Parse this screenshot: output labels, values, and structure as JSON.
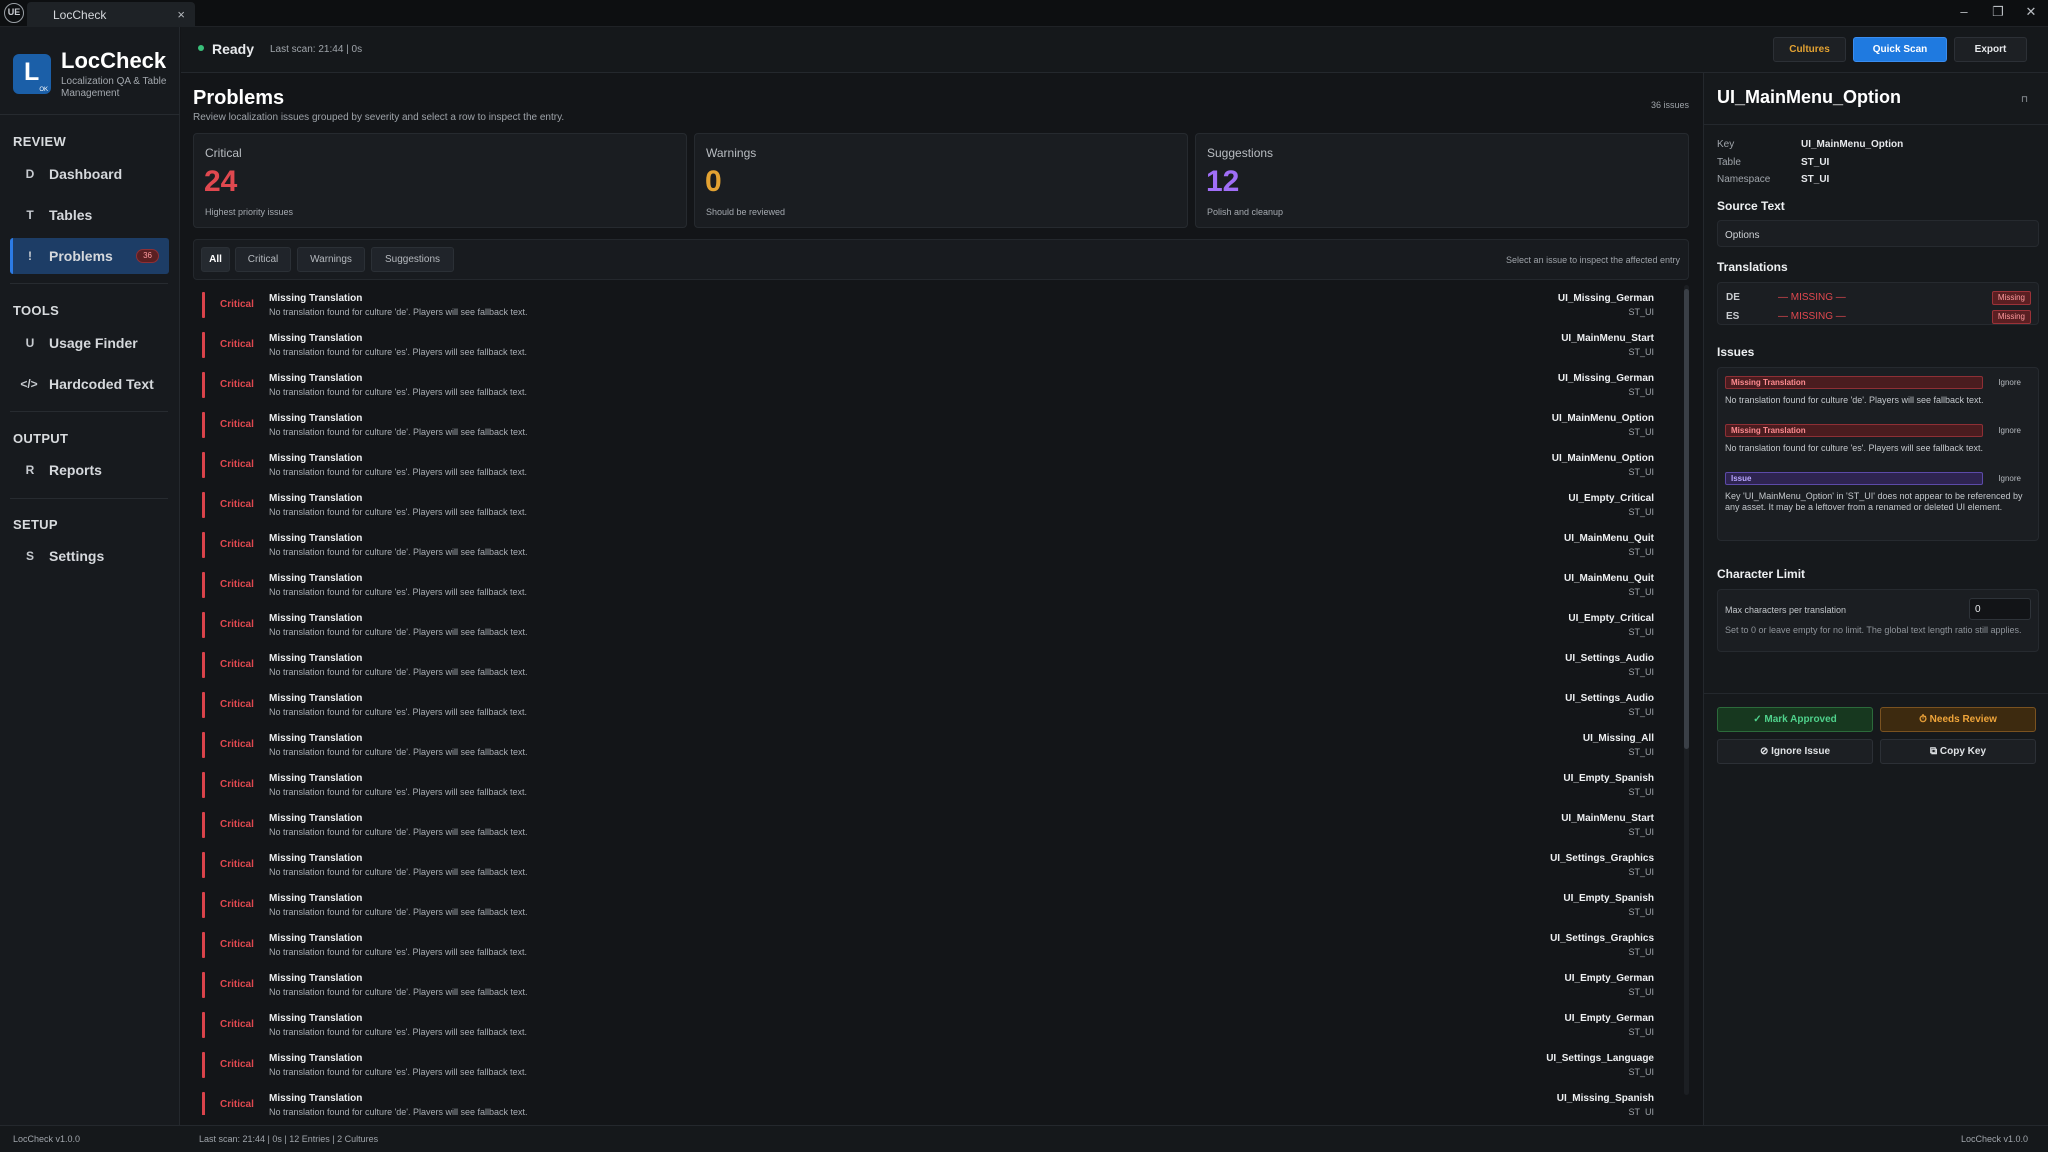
{
  "window": {
    "logo": "UE",
    "tab_label": "LocCheck",
    "tab_close": "×",
    "minimize": "–",
    "restore": "❐",
    "close": "✕"
  },
  "brand": {
    "logo_letter": "L",
    "logo_badge": "OK",
    "title": "LocCheck",
    "subtitle": "Localization QA & Table Management"
  },
  "sidebar": {
    "sections": [
      {
        "label": "REVIEW",
        "items": [
          {
            "icon": "D",
            "label": "Dashboard",
            "active": false
          },
          {
            "icon": "T",
            "label": "Tables",
            "active": false
          },
          {
            "icon": "!",
            "label": "Problems",
            "active": true,
            "badge": "36"
          }
        ]
      },
      {
        "label": "TOOLS",
        "items": [
          {
            "icon": "U",
            "label": "Usage Finder",
            "active": false
          },
          {
            "icon": "</>",
            "label": "Hardcoded Text",
            "active": false
          }
        ]
      },
      {
        "label": "OUTPUT",
        "items": [
          {
            "icon": "R",
            "label": "Reports",
            "active": false
          }
        ]
      },
      {
        "label": "SETUP",
        "items": [
          {
            "icon": "S",
            "label": "Settings",
            "active": false
          }
        ]
      }
    ]
  },
  "topbar": {
    "status": "Ready",
    "last_scan": "Last scan: 21:44  |  0s",
    "buttons": {
      "cultures": "Cultures",
      "quick_scan": "Quick Scan",
      "export": "Export"
    }
  },
  "colors": {
    "accent": "#1f7ae0",
    "critical": "#e0484f",
    "warning": "#e3a232",
    "suggestion": "#a06ef7",
    "approve": "#4fd18b",
    "review": "#f0a53a"
  },
  "main": {
    "title": "Problems",
    "subtitle": "Review localization issues grouped by severity and select a row to inspect the entry.",
    "issue_count": "36 issues",
    "cards": [
      {
        "title": "Critical",
        "value": "24",
        "sub": "Highest priority issues"
      },
      {
        "title": "Warnings",
        "value": "0",
        "sub": "Should be reviewed"
      },
      {
        "title": "Suggestions",
        "value": "12",
        "sub": "Polish and cleanup"
      }
    ],
    "filters": [
      "All",
      "Critical",
      "Warnings",
      "Suggestions"
    ],
    "active_filter": "All",
    "filter_hint": "Select an issue to inspect the affected entry",
    "rows": [
      {
        "severity": "Critical",
        "title": "Missing Translation",
        "desc": "No translation found for culture 'de'. Players will see fallback text.",
        "key": "UI_Missing_German",
        "table": "ST_UI"
      },
      {
        "severity": "Critical",
        "title": "Missing Translation",
        "desc": "No translation found for culture 'es'. Players will see fallback text.",
        "key": "UI_MainMenu_Start",
        "table": "ST_UI"
      },
      {
        "severity": "Critical",
        "title": "Missing Translation",
        "desc": "No translation found for culture 'es'. Players will see fallback text.",
        "key": "UI_Missing_German",
        "table": "ST_UI"
      },
      {
        "severity": "Critical",
        "title": "Missing Translation",
        "desc": "No translation found for culture 'de'. Players will see fallback text.",
        "key": "UI_MainMenu_Option",
        "table": "ST_UI"
      },
      {
        "severity": "Critical",
        "title": "Missing Translation",
        "desc": "No translation found for culture 'es'. Players will see fallback text.",
        "key": "UI_MainMenu_Option",
        "table": "ST_UI"
      },
      {
        "severity": "Critical",
        "title": "Missing Translation",
        "desc": "No translation found for culture 'es'. Players will see fallback text.",
        "key": "UI_Empty_Critical",
        "table": "ST_UI"
      },
      {
        "severity": "Critical",
        "title": "Missing Translation",
        "desc": "No translation found for culture 'de'. Players will see fallback text.",
        "key": "UI_MainMenu_Quit",
        "table": "ST_UI"
      },
      {
        "severity": "Critical",
        "title": "Missing Translation",
        "desc": "No translation found for culture 'es'. Players will see fallback text.",
        "key": "UI_MainMenu_Quit",
        "table": "ST_UI"
      },
      {
        "severity": "Critical",
        "title": "Missing Translation",
        "desc": "No translation found for culture 'de'. Players will see fallback text.",
        "key": "UI_Empty_Critical",
        "table": "ST_UI"
      },
      {
        "severity": "Critical",
        "title": "Missing Translation",
        "desc": "No translation found for culture 'de'. Players will see fallback text.",
        "key": "UI_Settings_Audio",
        "table": "ST_UI"
      },
      {
        "severity": "Critical",
        "title": "Missing Translation",
        "desc": "No translation found for culture 'es'. Players will see fallback text.",
        "key": "UI_Settings_Audio",
        "table": "ST_UI"
      },
      {
        "severity": "Critical",
        "title": "Missing Translation",
        "desc": "No translation found for culture 'de'. Players will see fallback text.",
        "key": "UI_Missing_All",
        "table": "ST_UI"
      },
      {
        "severity": "Critical",
        "title": "Missing Translation",
        "desc": "No translation found for culture 'es'. Players will see fallback text.",
        "key": "UI_Empty_Spanish",
        "table": "ST_UI"
      },
      {
        "severity": "Critical",
        "title": "Missing Translation",
        "desc": "No translation found for culture 'de'. Players will see fallback text.",
        "key": "UI_MainMenu_Start",
        "table": "ST_UI"
      },
      {
        "severity": "Critical",
        "title": "Missing Translation",
        "desc": "No translation found for culture 'de'. Players will see fallback text.",
        "key": "UI_Settings_Graphics",
        "table": "ST_UI"
      },
      {
        "severity": "Critical",
        "title": "Missing Translation",
        "desc": "No translation found for culture 'de'. Players will see fallback text.",
        "key": "UI_Empty_Spanish",
        "table": "ST_UI"
      },
      {
        "severity": "Critical",
        "title": "Missing Translation",
        "desc": "No translation found for culture 'es'. Players will see fallback text.",
        "key": "UI_Settings_Graphics",
        "table": "ST_UI"
      },
      {
        "severity": "Critical",
        "title": "Missing Translation",
        "desc": "No translation found for culture 'de'. Players will see fallback text.",
        "key": "UI_Empty_German",
        "table": "ST_UI"
      },
      {
        "severity": "Critical",
        "title": "Missing Translation",
        "desc": "No translation found for culture 'es'. Players will see fallback text.",
        "key": "UI_Empty_German",
        "table": "ST_UI"
      },
      {
        "severity": "Critical",
        "title": "Missing Translation",
        "desc": "No translation found for culture 'es'. Players will see fallback text.",
        "key": "UI_Settings_Language",
        "table": "ST_UI"
      },
      {
        "severity": "Critical",
        "title": "Missing Translation",
        "desc": "No translation found for culture 'de'. Players will see fallback text.",
        "key": "UI_Missing_Spanish",
        "table": "ST_UI"
      }
    ]
  },
  "panel": {
    "title": "UI_MainMenu_Option",
    "pin": "⊓",
    "meta": {
      "key_label": "Key",
      "key": "UI_MainMenu_Option",
      "table_label": "Table",
      "table": "ST_UI",
      "namespace_label": "Namespace",
      "namespace": "ST_UI"
    },
    "source_heading": "Source Text",
    "source_text": "Options",
    "translations_heading": "Translations",
    "translations": [
      {
        "lang": "DE",
        "value": "— MISSING —",
        "badge": "Missing"
      },
      {
        "lang": "ES",
        "value": "— MISSING —",
        "badge": "Missing"
      }
    ],
    "issues_heading": "Issues",
    "issues": [
      {
        "tag": "Missing Translation",
        "ignore": "Ignore",
        "desc": "No translation found for culture 'de'. Players will see fallback text."
      },
      {
        "tag": "Missing Translation",
        "ignore": "Ignore",
        "desc": "No translation found for culture 'es'. Players will see fallback text."
      },
      {
        "tag": "Issue",
        "ignore": "Ignore",
        "desc": "Key 'UI_MainMenu_Option' in 'ST_UI' does not appear to be referenced by any asset. It may be a leftover from a renamed or deleted UI element."
      }
    ],
    "charlimit_heading": "Character Limit",
    "charlimit_label": "Max characters per translation",
    "charlimit_value": "0",
    "charlimit_help": "Set to 0 or leave empty for no limit. The global text length ratio still applies.",
    "actions": {
      "approve": "✓ Mark Approved",
      "review": "⏱ Needs Review",
      "ignore": "⊘ Ignore Issue",
      "copy": "⧉ Copy Key"
    }
  },
  "statusbar": {
    "version": "LocCheck v1.0.0",
    "stats": "Last scan: 21:44  |  0s    | 12 Entries    | 2 Cultures",
    "version_right": "LocCheck v1.0.0"
  }
}
